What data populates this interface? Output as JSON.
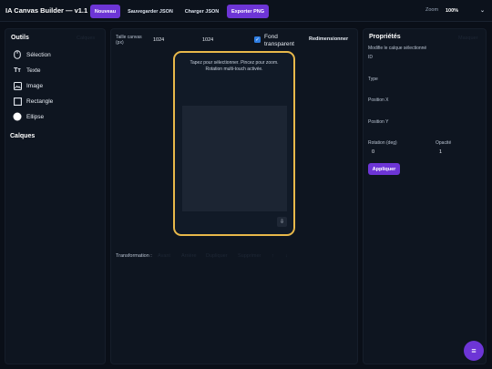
{
  "app": {
    "title": "IA Canvas Builder — v1.1"
  },
  "toolbar": {
    "new_label": "Nouveau",
    "save_json_label": "Sauvegarder JSON",
    "load_json_label": "Charger JSON",
    "export_png_label": "Exporter PNG",
    "zoom_label": "Zoom",
    "zoom_value": "100%"
  },
  "tools_panel": {
    "title": "Outils",
    "faded_label": "Calques",
    "tools": [
      {
        "label": "Sélection",
        "icon": "mouse-icon"
      },
      {
        "label": "Texte",
        "icon": "text-icon"
      },
      {
        "label": "Image",
        "icon": "image-icon"
      },
      {
        "label": "Rectangle",
        "icon": "rectangle-icon"
      },
      {
        "label": "Ellipse",
        "icon": "ellipse-icon"
      }
    ],
    "layers_title": "Calques"
  },
  "canvas_panel": {
    "size_label": "Taille canvas (px)",
    "width": "1024",
    "height": "1024",
    "transparent_label": "Fond transparent",
    "transparent_checked": true,
    "resize_label": "Redimensionner",
    "hint_line1": "Tapez pour sélectionner. Pincez pour zoom.",
    "hint_line2": "Rotation multi-touch activée.",
    "small_button": "⇩",
    "transform_label": "Transformation :",
    "transform_options": [
      "Avant",
      "Arrière",
      "Dupliquer",
      "Supprimer",
      "↑",
      "↓"
    ]
  },
  "props_panel": {
    "title": "Propriétés",
    "faded_label": "Masquer",
    "subtitle": "Modifie le calque sélectionné",
    "id_label": "ID",
    "type_label": "Type",
    "posx_label": "Position X",
    "posy_label": "Position Y",
    "rotation_label": "Rotation (deg)",
    "rotation_value": "0",
    "opacity_label": "Opacité",
    "opacity_value": "1",
    "apply_label": "Appliquer"
  },
  "fab": {
    "icon": "menu-icon",
    "glyph": "≡"
  },
  "colors": {
    "accent": "#6d35d6",
    "canvas_border": "#e8b84a",
    "background": "#0a0f18",
    "panel": "#0e1520",
    "checkbox": "#2f7de1"
  }
}
